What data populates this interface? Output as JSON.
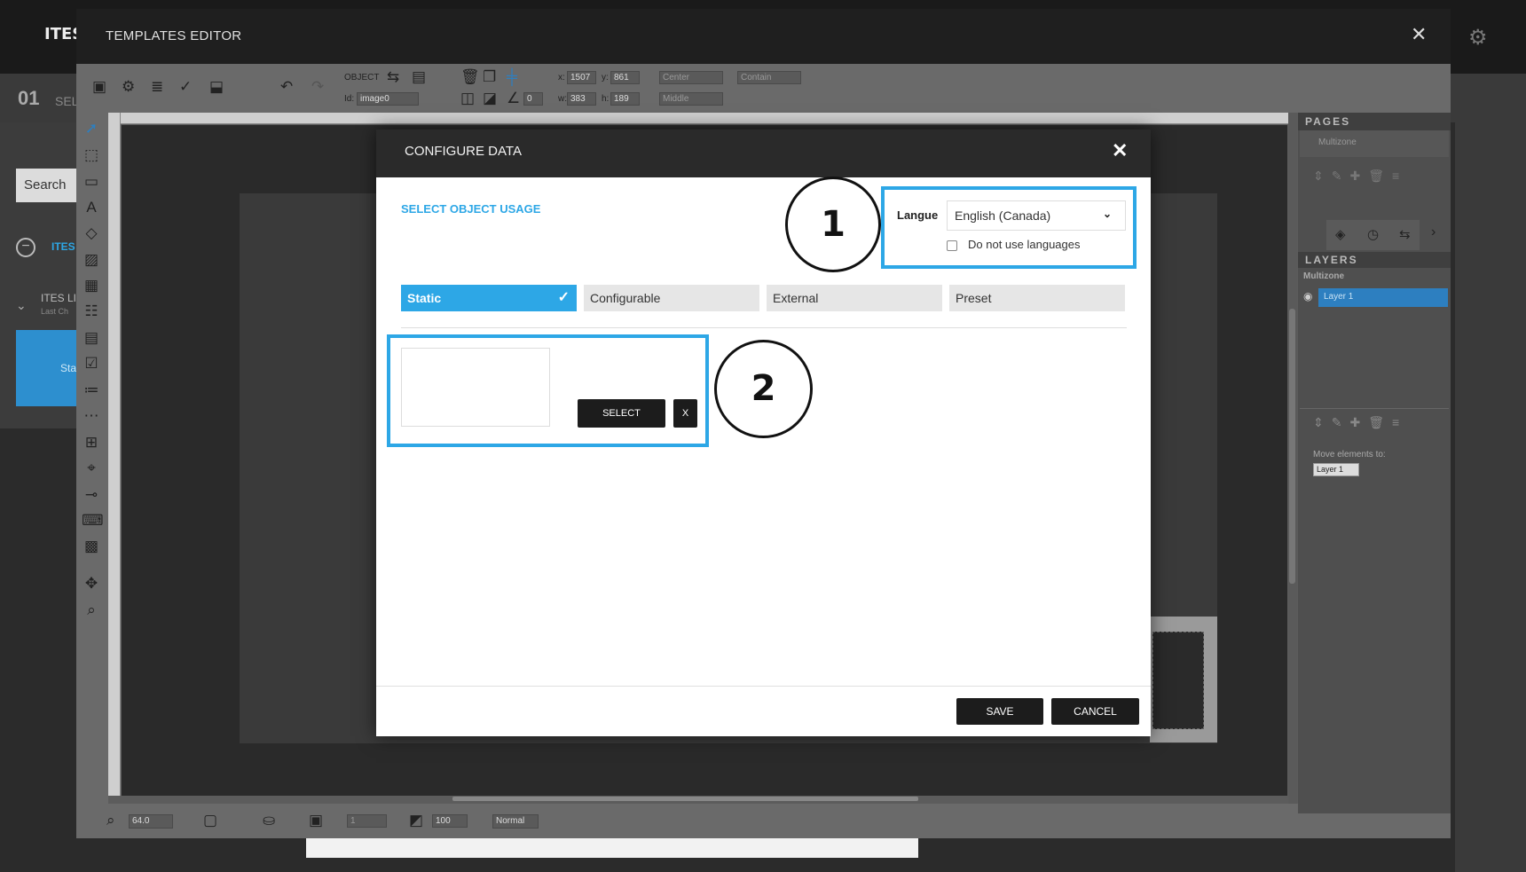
{
  "background": {
    "logo": "ITES",
    "step_number": "01",
    "step_label": "SEL",
    "search_label": "Search",
    "tree_label": "ITES",
    "list_title": "ITES LI",
    "list_subtitle": "Last Ch",
    "card_label": "Sta"
  },
  "editor": {
    "title": "TEMPLATES EDITOR",
    "close_icon": "✕",
    "toolbar": {
      "object_label": "OBJECT",
      "id_label": "Id:",
      "id_value": "image0",
      "x_label": "x:",
      "x_value": "1507",
      "y_label": "y:",
      "y_value": "861",
      "w_label": "w:",
      "w_value": "383",
      "h_label": "h:",
      "h_value": "189",
      "angle_value": "0",
      "halign": "Center",
      "valign": "Middle",
      "fit": "Contain"
    },
    "bottombar": {
      "zoom": "64.0",
      "border_width": "1",
      "opacity": "100",
      "blend": "Normal"
    },
    "right_panel": {
      "pages_title": "PAGES",
      "pages_item": "Multizone",
      "layers_title": "LAYERS",
      "layers_group": "Multizone",
      "layer_name": "Layer 1",
      "move_label": "Move elements to:",
      "move_value": "Layer 1"
    }
  },
  "modal": {
    "title": "CONFIGURE DATA",
    "close_icon": "✕",
    "usage_title": "SELECT OBJECT USAGE",
    "language": {
      "label": "Langue",
      "value": "English (Canada)",
      "no_lang_label": "Do not use languages",
      "no_lang_checked": false
    },
    "tabs": [
      {
        "label": "Static",
        "active": true
      },
      {
        "label": "Configurable",
        "active": false
      },
      {
        "label": "External",
        "active": false
      },
      {
        "label": "Preset",
        "active": false
      }
    ],
    "select_button": "SELECT",
    "clear_button": "X",
    "save_button": "SAVE",
    "cancel_button": "CANCEL"
  },
  "callouts": {
    "one": "1",
    "two": "2"
  },
  "colors": {
    "accent": "#2da7e6",
    "modal_header": "#2a2a2a",
    "button_dark": "#1c1c1c"
  }
}
